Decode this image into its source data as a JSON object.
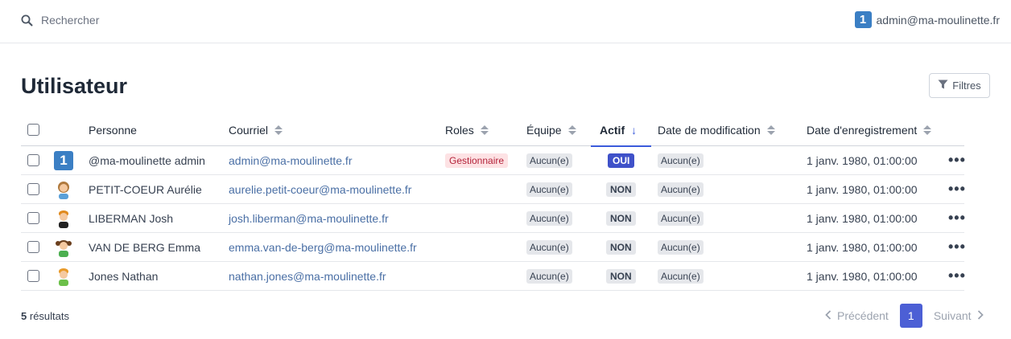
{
  "header": {
    "search_placeholder": "Rechercher",
    "account_email": "admin@ma-moulinette.fr",
    "account_logo": "1"
  },
  "page": {
    "title": "Utilisateur",
    "filters_label": "Filtres"
  },
  "table": {
    "columns": {
      "person": "Personne",
      "email": "Courriel",
      "roles": "Roles",
      "team": "Équipe",
      "active": "Actif",
      "modified": "Date de modification",
      "registered": "Date d'enregistrement"
    },
    "rows": [
      {
        "avatar": "logo-one",
        "person": "@ma-moulinette admin",
        "email": "admin@ma-moulinette.fr",
        "role": "Gestionnaire",
        "team": "Aucun(e)",
        "active": "OUI",
        "modified": "Aucun(e)",
        "registered": "1 janv. 1980, 01:00:00",
        "actions": "•••"
      },
      {
        "avatar": "girl-avatar",
        "person": "PETIT-COEUR Aurélie",
        "email": "aurelie.petit-coeur@ma-moulinette.fr",
        "role": "",
        "team": "Aucun(e)",
        "active": "NON",
        "modified": "Aucun(e)",
        "registered": "1 janv. 1980, 01:00:00",
        "actions": "•••"
      },
      {
        "avatar": "boy-avatar",
        "person": "LIBERMAN Josh",
        "email": "josh.liberman@ma-moulinette.fr",
        "role": "",
        "team": "Aucun(e)",
        "active": "NON",
        "modified": "Aucun(e)",
        "registered": "1 janv. 1980, 01:00:00",
        "actions": "•••"
      },
      {
        "avatar": "girl-pigtails-avatar",
        "person": "VAN DE BERG Emma",
        "email": "emma.van-de-berg@ma-moulinette.fr",
        "role": "",
        "team": "Aucun(e)",
        "active": "NON",
        "modified": "Aucun(e)",
        "registered": "1 janv. 1980, 01:00:00",
        "actions": "•••"
      },
      {
        "avatar": "boy-green-avatar",
        "person": "Jones Nathan",
        "email": "nathan.jones@ma-moulinette.fr",
        "role": "",
        "team": "Aucun(e)",
        "active": "NON",
        "modified": "Aucun(e)",
        "registered": "1 janv. 1980, 01:00:00",
        "actions": "•••"
      }
    ]
  },
  "footer": {
    "count": "5",
    "count_label": "résultats",
    "prev": "Précédent",
    "current_page": "1",
    "next": "Suivant"
  },
  "colors": {
    "accent": "#4c5fd5",
    "link": "#4a6fa5",
    "role_badge_bg": "#fde2e4",
    "role_badge_text": "#b4233a",
    "logo_blue": "#3b7fc4"
  }
}
